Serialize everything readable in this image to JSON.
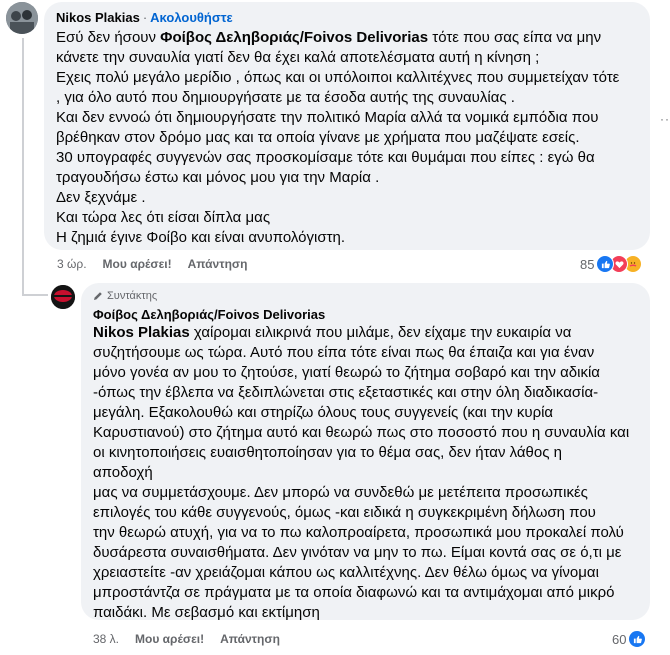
{
  "comment1": {
    "author": "Nikos Plakias",
    "follow_label": "Ακολουθήστε",
    "separator": "·",
    "segment1": "Εσύ δεν ήσουν ",
    "bold_name": "Φοίβος Δεληβοριάς/Foivos Delivorias",
    "segment2": " τότε που σας είπα να μην",
    "lines": [
      "κάνετε την συναυλία γιατί δεν θα έχει καλά αποτελέσματα αυτή η κίνηση ;",
      "Εχεις πολύ μεγάλο μερίδιο , όπως και οι υπόλοιποι καλλιτέχνες που συμμετείχαν τότε",
      ", για όλο αυτό που δημιουργήσατε με τα έσοδα αυτής της συναυλίας .",
      "Και δεν εννοώ ότι δημιουργήσατε την πολιτικό Μαρία αλλά τα νομικά εμπόδια που",
      "βρέθηκαν στον δρόμο μας και τα οποία γίνανε με χρήματα που μαζέψατε εσείς.",
      "30 υπογραφές συγγενών σας προσκομίσαμε τότε και θυμάμαι που είπες : εγώ θα",
      "τραγουδήσω έστω και μόνος μου για την Μαρία .",
      "Δεν ξεχνάμε .",
      "Και τώρα λες ότι είσαι δίπλα μας",
      "Η ζημιά έγινε Φοίβο και είναι ανυπολόγιστη."
    ],
    "time": "3 ώρ.",
    "like_label": "Μου αρέσει!",
    "reply_label": "Απάντηση",
    "reaction_count": "85"
  },
  "reply": {
    "badge_label": "Συντάκτης",
    "author": "Φοίβος Δεληβοριάς/Foivos Delivorias",
    "mention": "Nikos Plakias",
    "first_line_rest": " χαίρομαι ειλικρινά που μιλάμε, δεν είχαμε την ευκαιρία να",
    "lines": [
      "συζητήσουμε ως τώρα. Αυτό που είπα τότε είναι πως θα έπαιζα και για έναν",
      "μόνο γονέα αν μου το ζητούσε, γιατί θεωρώ το ζήτημα σοβαρό και την αδικία",
      "-όπως την έβλεπα να ξεδιπλώνεται στις εξεταστικές και στην όλη διαδικασία-",
      "μεγάλη. Εξακολουθώ και στηρίζω όλους τους συγγενείς (και την κυρία",
      "Καρυστιανού) στο ζήτημα αυτό και θεωρώ πως στο ποσοστό που η συναυλία και",
      "οι κινητοποιήσεις ευαισθητοποίησαν για το θέμα σας, δεν ήταν λάθος η",
      "αποδοχή",
      "μας να συμμετάσχουμε. Δεν μπορώ να συνδεθώ με μετέπειτα προσωπικές",
      "επιλογές του κάθε συγγενούς, όμως -και ειδικά η συγκεκριμένη δήλωση που",
      "την θεωρώ ατυχή, για να το πω καλοπροαίρετα, προσωπικά μου προκαλεί πολύ",
      "δυσάρεστα συναισθήματα. Δεν γινόταν να μην το πω. Είμαι κοντά σας σε ό,τι με",
      "χρειαστείτε -αν χρειάζομαι κάπου ως καλλιτέχνης. Δεν θέλω όμως να γίνομαι",
      "μπροστάντζα σε πράγματα με τα οποία διαφωνώ και τα αντιμάχομαι από μικρό",
      "παιδάκι. Με σεβασμό και εκτίμηση"
    ],
    "time": "38 λ.",
    "like_label": "Μου αρέσει!",
    "reply_label": "Απάντηση",
    "reaction_count": "60"
  },
  "icons": {
    "like": "like-icon",
    "love": "love-icon",
    "care": "care-icon",
    "pencil": "pencil-icon",
    "more": "more-dots-icon"
  },
  "colors": {
    "accent": "#0064d1",
    "like_blue": "#1877f2",
    "love_red": "#f33e58",
    "care_yellow": "#f7b125",
    "bubble_bg": "#f0f2f5"
  }
}
